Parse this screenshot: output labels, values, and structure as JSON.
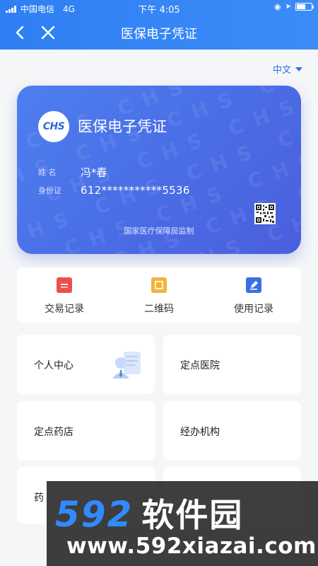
{
  "status_bar": {
    "carrier": "中国电信",
    "network": "4G",
    "time": "下午 4:05"
  },
  "nav": {
    "title": "医保电子凭证"
  },
  "language": {
    "selected": "中文"
  },
  "card": {
    "logo_text": "CHS",
    "title": "医保电子凭证",
    "name_label": "姓 名",
    "name_value": "冯*春",
    "id_label": "身份证",
    "id_value": "612***********5536",
    "footer": "国家医疗保障局监制"
  },
  "actions": [
    {
      "label": "交易记录",
      "color": "#e8524a"
    },
    {
      "label": "二维码",
      "color": "#f3b33b"
    },
    {
      "label": "使用记录",
      "color": "#3d6ee8"
    }
  ],
  "tiles": [
    {
      "label": "个人中心"
    },
    {
      "label": "定点医院"
    },
    {
      "label": "定点药店"
    },
    {
      "label": "经办机构"
    },
    {
      "label": "药"
    },
    {
      "label": ""
    }
  ],
  "watermark": {
    "digits": "592",
    "brand": "软件园",
    "url": "www.592xiazai.com"
  },
  "colors": {
    "primary": "#2f7ff4",
    "card": "#4a6ee6"
  }
}
